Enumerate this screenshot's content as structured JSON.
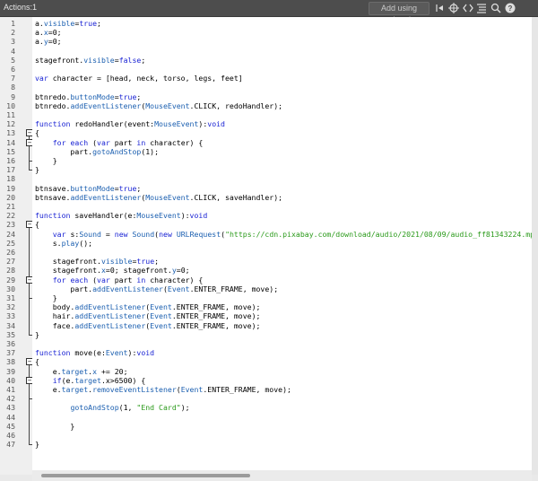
{
  "window": {
    "title": "Actions:1"
  },
  "toolbar": {
    "wizard_label": "Add using wizard",
    "icons": [
      "insert-target-icon",
      "crosshair-icon",
      "code-brackets-icon",
      "format-icon",
      "search-icon",
      "help-icon"
    ]
  },
  "editor": {
    "lines": [
      "a.visible=true;",
      "a.x=0;",
      "a.y=0;",
      "",
      "stagefront.visible=false;",
      "",
      "var character = [head, neck, torso, legs, feet]",
      "",
      "btnredo.buttonMode=true;",
      "btnredo.addEventListener(MouseEvent.CLICK, redoHandler);",
      "",
      "function redoHandler(event:MouseEvent):void",
      "{",
      "    for each (var part in character) {",
      "        part.gotoAndStop(1);",
      "    }",
      "}",
      "",
      "btnsave.buttonMode=true;",
      "btnsave.addEventListener(MouseEvent.CLICK, saveHandler);",
      "",
      "function saveHandler(e:MouseEvent):void",
      "{",
      "    var s:Sound = new Sound(new URLRequest(\"https://cdn.pixabay.com/download/audio/2021/08/09/audio_ff81343224.mp",
      "    s.play();",
      "",
      "    stagefront.visible=true;",
      "    stagefront.x=0; stagefront.y=0;",
      "    for each (var part in character) {",
      "        part.addEventListener(Event.ENTER_FRAME, move);",
      "    }",
      "    body.addEventListener(Event.ENTER_FRAME, move);",
      "    hair.addEventListener(Event.ENTER_FRAME, move);",
      "    face.addEventListener(Event.ENTER_FRAME, move);",
      "}",
      "",
      "function move(e:Event):void",
      "{",
      "    e.target.x += 20;",
      "    if(e.target.x>6500) {",
      "    e.target.removeEventListener(Event.ENTER_FRAME, move);",
      "",
      "        gotoAndStop(1, \"End Card\");",
      "",
      "        }",
      "",
      "}"
    ]
  },
  "colors": {
    "keyword": "#1a23d4",
    "property": "#1b5fb0",
    "string": "#2a9a1a"
  }
}
